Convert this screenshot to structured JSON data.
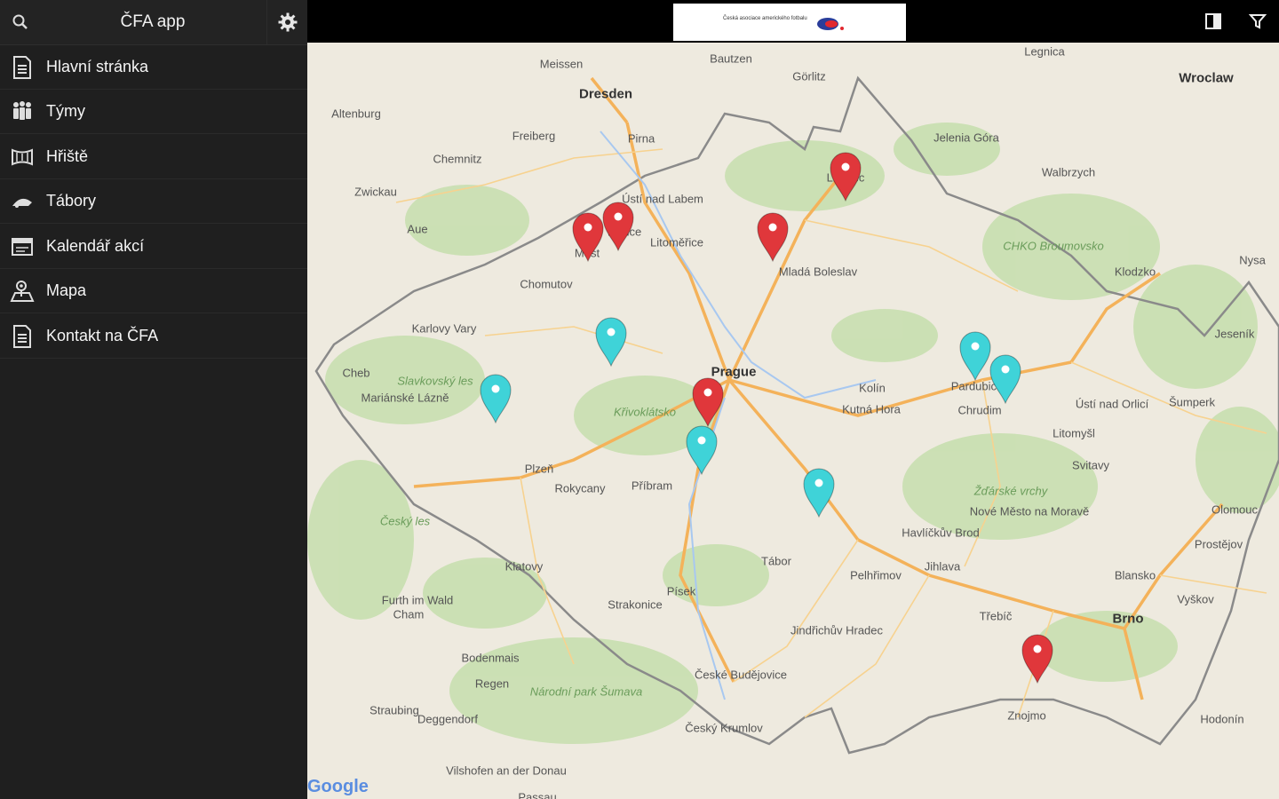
{
  "app": {
    "title": "ČFA app"
  },
  "sidebar": {
    "items": [
      {
        "label": "Hlavní stránka",
        "icon": "document-icon"
      },
      {
        "label": "Týmy",
        "icon": "team-icon"
      },
      {
        "label": "Hřiště",
        "icon": "field-icon"
      },
      {
        "label": "Tábory",
        "icon": "camp-icon"
      },
      {
        "label": "Kalendář akcí",
        "icon": "calendar-icon"
      },
      {
        "label": "Mapa",
        "icon": "map-icon"
      },
      {
        "label": "Kontakt na ČFA",
        "icon": "document-icon"
      }
    ]
  },
  "ad": {
    "text": "Česká asociace amerického fotbalu"
  },
  "map": {
    "attribution": "Google",
    "pin_colors": {
      "red": "#e0373b",
      "cyan": "#3fd3d8"
    },
    "cities": [
      {
        "name": "Dresden",
        "big": true
      },
      {
        "name": "Bautzen"
      },
      {
        "name": "Görlitz"
      },
      {
        "name": "Legnica"
      },
      {
        "name": "Wroclaw",
        "big": true
      },
      {
        "name": "Meissen"
      },
      {
        "name": "Chemnitz"
      },
      {
        "name": "Freiberg"
      },
      {
        "name": "Zwickau"
      },
      {
        "name": "Altenburg"
      },
      {
        "name": "Aue"
      },
      {
        "name": "Pirna"
      },
      {
        "name": "Jelenia Góra"
      },
      {
        "name": "Walbrzych"
      },
      {
        "name": "Liberec"
      },
      {
        "name": "Ústí nad Labem"
      },
      {
        "name": "Teplice"
      },
      {
        "name": "Most"
      },
      {
        "name": "Chomutov"
      },
      {
        "name": "Litoměřice"
      },
      {
        "name": "Mladá Boleslav"
      },
      {
        "name": "Karlovy Vary"
      },
      {
        "name": "Cheb"
      },
      {
        "name": "Mariánské Lázně"
      },
      {
        "name": "Prague",
        "big": true
      },
      {
        "name": "Kolín"
      },
      {
        "name": "Kutná Hora"
      },
      {
        "name": "Pardubice"
      },
      {
        "name": "Chrudim"
      },
      {
        "name": "Ústí nad Orlicí"
      },
      {
        "name": "Plzeň"
      },
      {
        "name": "Rokycany"
      },
      {
        "name": "Příbram"
      },
      {
        "name": "Klatovy"
      },
      {
        "name": "Písek"
      },
      {
        "name": "Strakonice"
      },
      {
        "name": "Tábor"
      },
      {
        "name": "Jihlava"
      },
      {
        "name": "Havlíčkův Brod"
      },
      {
        "name": "Pelhřimov"
      },
      {
        "name": "Jindřichův Hradec"
      },
      {
        "name": "České Budějovice"
      },
      {
        "name": "Český Krumlov"
      },
      {
        "name": "Třebíč"
      },
      {
        "name": "Brno",
        "big": true
      },
      {
        "name": "Znojmo"
      },
      {
        "name": "Olomouc"
      },
      {
        "name": "Prostějov"
      },
      {
        "name": "Vyškov"
      },
      {
        "name": "Blansko"
      },
      {
        "name": "Svitavy"
      },
      {
        "name": "Šumperk"
      },
      {
        "name": "Litomyšl"
      },
      {
        "name": "Nové Město na Moravě"
      },
      {
        "name": "Klodzko"
      },
      {
        "name": "Nysa"
      },
      {
        "name": "Jeseník"
      },
      {
        "name": "Deggendorf"
      },
      {
        "name": "Straubing"
      },
      {
        "name": "Regen"
      },
      {
        "name": "Bodenmais"
      },
      {
        "name": "Passau"
      },
      {
        "name": "Vilshofen an der Donau"
      },
      {
        "name": "Furth im Wald"
      },
      {
        "name": "Cham"
      },
      {
        "name": "Hodonín"
      },
      {
        "name": "Slavkovský les",
        "park": true
      },
      {
        "name": "Křivoklátsko",
        "park": true
      },
      {
        "name": "Český les",
        "park": true
      },
      {
        "name": "Národní park Šumava",
        "park": true
      },
      {
        "name": "Žďárské vrchy",
        "park": true
      },
      {
        "name": "CHKO Broumovsko",
        "park": true
      }
    ],
    "pins": [
      {
        "color": "red",
        "place": "Most"
      },
      {
        "color": "red",
        "place": "Ústí nad Labem"
      },
      {
        "color": "red",
        "place": "Mladá Boleslav"
      },
      {
        "color": "red",
        "place": "Liberec"
      },
      {
        "color": "red",
        "place": "Prague"
      },
      {
        "color": "red",
        "place": "Třebíč"
      },
      {
        "color": "cyan",
        "place": "Chomutov"
      },
      {
        "color": "cyan",
        "place": "Karlovy Vary"
      },
      {
        "color": "cyan",
        "place": "Prague south"
      },
      {
        "color": "cyan",
        "place": "Kutná Hora"
      },
      {
        "color": "cyan",
        "place": "Hradec Králové"
      },
      {
        "color": "cyan",
        "place": "Hradec Králové east"
      }
    ]
  }
}
